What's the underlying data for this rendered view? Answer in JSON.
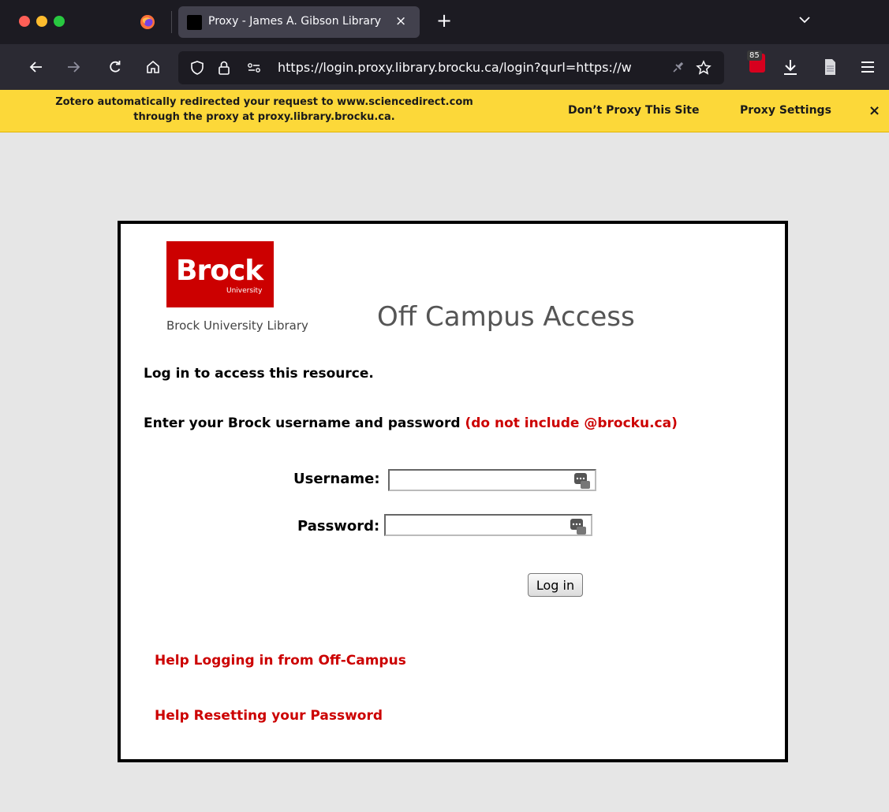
{
  "browser": {
    "tab": {
      "title": "Proxy - James A. Gibson Library",
      "close_glyph": "×"
    },
    "new_tab_glyph": "+",
    "url": "https://login.proxy.library.brocku.ca/login?qurl=https://w",
    "extension_badge_count": "85",
    "icons": {
      "back": "arrow-left-icon",
      "forward": "arrow-right-icon",
      "reload": "reload-icon",
      "home": "home-icon",
      "shield": "shield-icon",
      "lock": "lock-icon",
      "permissions": "permissions-icon",
      "bookmark": "star-icon",
      "downloads": "download-icon",
      "reader": "page-icon",
      "menu": "hamburger-menu-icon",
      "tab_list": "chevron-down-icon"
    }
  },
  "notification": {
    "message_line1": "Zotero automatically redirected your request to www.sciencedirect.com",
    "message_line2": "through the proxy at proxy.library.brocku.ca.",
    "dont_proxy_label": "Don’t Proxy This Site",
    "settings_label": "Proxy Settings",
    "close_glyph": "×"
  },
  "login": {
    "logo_word": "Brock",
    "logo_sub": "University",
    "library_label": "Brock University Library",
    "title": "Off Campus Access",
    "intro": "Log in to access this resource.",
    "instruction": "Enter your Brock username and password",
    "instruction_note": "(do not include @brocku.ca)",
    "username_label": "Username:",
    "username_value": "",
    "password_label": "Password:",
    "password_value": "",
    "submit_label": "Log in",
    "help_offcampus": "Help Logging in from Off-Campus",
    "help_password": "Help Resetting your Password"
  },
  "colors": {
    "brand_red": "#cc0000",
    "notification_yellow": "#fcd839",
    "toolbar_dark": "#2b2a33",
    "tabstrip_dark": "#1c1b22",
    "page_background": "#e6e6e6"
  }
}
